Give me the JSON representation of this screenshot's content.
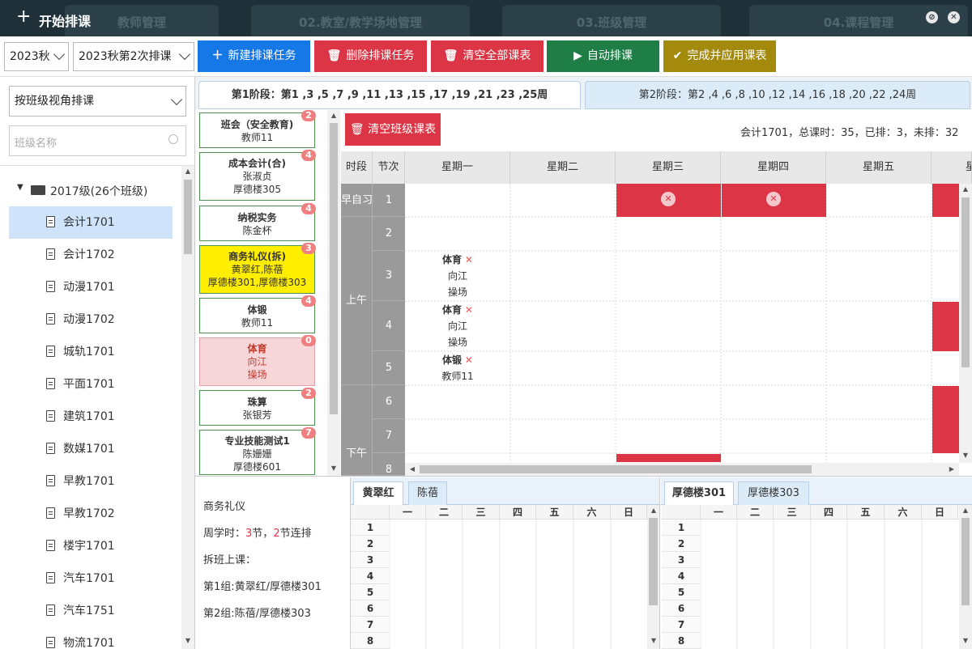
{
  "window": {
    "title": "开始排课",
    "bg_tabs": [
      "教师管理",
      "02.教室/教学场地管理",
      "03.班级管理",
      "04.课程管理"
    ]
  },
  "toolbar": {
    "term": "2023秋",
    "task": "2023秋第2次排课",
    "buttons": [
      {
        "label": "新建排课任务",
        "icon": "+",
        "color": "#1677e6"
      },
      {
        "label": "删除排课任务",
        "icon": "trash",
        "color": "#dc3545"
      },
      {
        "label": "清空全部课表",
        "icon": "trash",
        "color": "#dc3545"
      },
      {
        "label": "自动排课",
        "icon": "play",
        "color": "#1e7e45"
      },
      {
        "label": "完成并应用课表",
        "icon": "check",
        "color": "#a48a0c"
      }
    ]
  },
  "left": {
    "view_select": "按班级视角排课",
    "search_placeholder": "班级名称",
    "group": "2017级(26个班级)",
    "classes": [
      "会计1701",
      "会计1702",
      "动漫1701",
      "动漫1702",
      "城轨1701",
      "平面1701",
      "建筑1701",
      "数媒1701",
      "早教1701",
      "早教1702",
      "楼宇1701",
      "汽车1701",
      "汽车1751",
      "物流1701"
    ],
    "selected": "会计1701"
  },
  "stages": [
    {
      "label": "第1阶段：第1 ,3 ,5 ,7 ,9 ,11 ,13 ,15 ,17 ,19 ,21 ,23 ,25周",
      "active": true
    },
    {
      "label": "第2阶段：第2 ,4 ,6 ,8 ,10 ,12 ,14 ,16 ,18 ,20 ,22 ,24周",
      "active": false
    }
  ],
  "courses": [
    {
      "name": "班会（安全教育)",
      "lines": [
        "教师11"
      ],
      "count": "2",
      "style": "normal"
    },
    {
      "name": "成本会计(合)",
      "lines": [
        "张淑贞",
        "厚德楼305"
      ],
      "count": "4",
      "style": "normal"
    },
    {
      "name": "纳税实务",
      "lines": [
        "陈金杯"
      ],
      "count": "4",
      "style": "normal"
    },
    {
      "name": "商务礼仪(拆)",
      "lines": [
        "黄翠红,陈蓓",
        "厚德楼301,厚德楼303"
      ],
      "count": "3",
      "style": "yellow"
    },
    {
      "name": "体锻",
      "lines": [
        "教师11"
      ],
      "count": "4",
      "style": "normal"
    },
    {
      "name": "体育",
      "lines": [
        "向江",
        "操场"
      ],
      "count": "0",
      "style": "pink"
    },
    {
      "name": "珠算",
      "lines": [
        "张银芳"
      ],
      "count": "2",
      "style": "normal"
    },
    {
      "name": "专业技能测试1",
      "lines": [
        "陈姗姗",
        "厚德楼601"
      ],
      "count": "7",
      "style": "normal"
    }
  ],
  "timetable": {
    "clear_button": "清空班级课表",
    "summary": "会计1701，总课时：35，已排：3，未排：32",
    "header_time": "时段",
    "header_period": "节次",
    "days": [
      "星期一",
      "星期二",
      "星期三",
      "星期四",
      "星期五",
      "星"
    ],
    "segments": [
      "早自习",
      "上午",
      "下午"
    ],
    "periods": [
      "1",
      "2",
      "3",
      "4",
      "5",
      "6",
      "7",
      "8"
    ],
    "entries": [
      {
        "name": "体育",
        "l1": "向江",
        "l2": "操场"
      },
      {
        "name": "体育",
        "l1": "向江",
        "l2": "操场"
      },
      {
        "name": "体锻",
        "l1": "教师11",
        "l2": ""
      }
    ]
  },
  "info": {
    "course": "商务礼仪",
    "weekly_prefix": "周学时：",
    "weekly_hours": "3",
    "weekly_mid": "节，",
    "consecutive": "2",
    "weekly_suffix": "节连排",
    "split": "拆班上课：",
    "group1": "第1组:黄翠红/厚德楼301",
    "group2": "第2组:陈蓓/厚德楼303"
  },
  "teacher_tabs": [
    "黄翠红",
    "陈蓓"
  ],
  "room_tabs": [
    "厚德楼301",
    "厚德楼303"
  ],
  "mini_days": [
    "一",
    "二",
    "三",
    "四",
    "五",
    "六",
    "日"
  ],
  "mini_rows": [
    "1",
    "2",
    "3",
    "4",
    "5",
    "6",
    "7",
    "8"
  ]
}
